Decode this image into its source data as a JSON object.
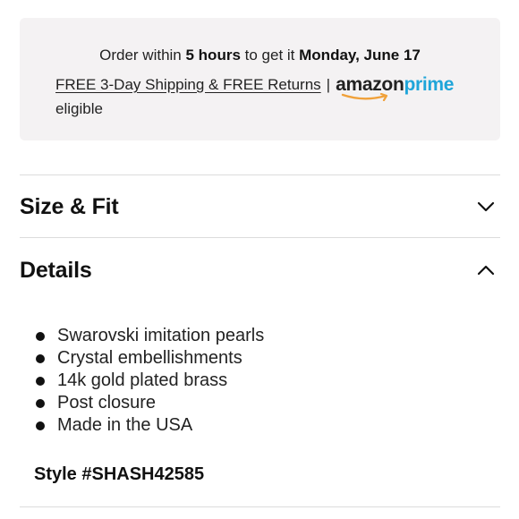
{
  "delivery": {
    "prefix": "Order within",
    "hours": "5 hours",
    "middle": "to get it",
    "date": "Monday, June 17",
    "shipping_link": "FREE 3-Day Shipping & FREE Returns",
    "separator": "|",
    "prime_brand": "amazon",
    "prime_word": "prime",
    "eligible": "eligible",
    "prime_color": "#1fa5d9"
  },
  "sections": {
    "size_fit": {
      "title": "Size & Fit",
      "icon": "chevron-down-icon",
      "expanded": false
    },
    "details": {
      "title": "Details",
      "icon": "chevron-up-icon",
      "expanded": true
    }
  },
  "details": {
    "items": [
      "Swarovski imitation pearls",
      "Crystal embellishments",
      "14k gold plated brass",
      "Post closure",
      "Made in the USA"
    ],
    "style_number": "Style #SHASH42585"
  }
}
